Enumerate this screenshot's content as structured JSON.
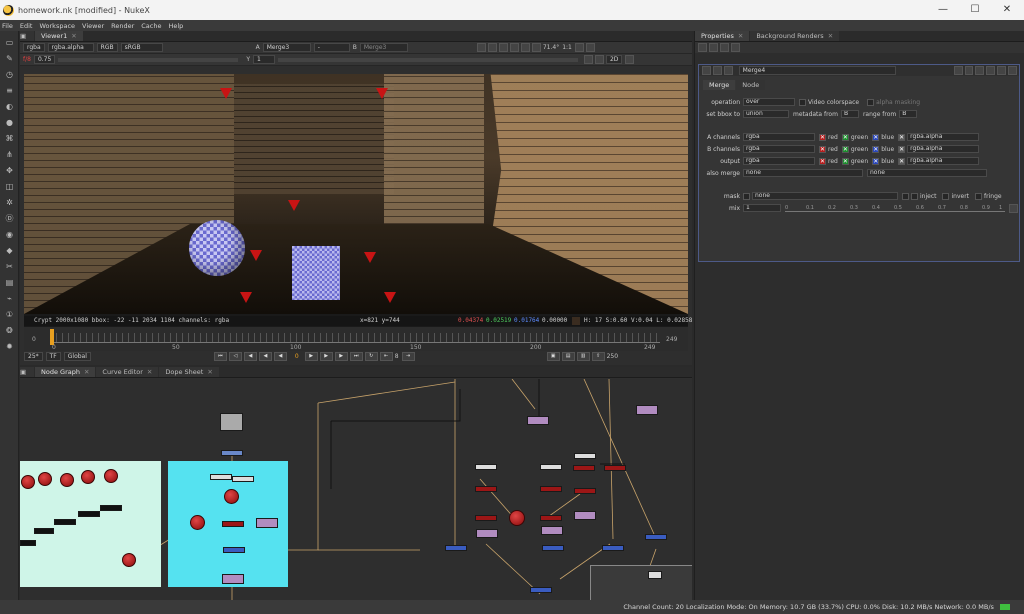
{
  "window": {
    "title": "homework.nk [modified] - NukeX",
    "minimize": "—",
    "maximize": "☐",
    "close": "✕"
  },
  "menu": [
    "File",
    "Edit",
    "Workspace",
    "Viewer",
    "Render",
    "Cache",
    "Help"
  ],
  "viewer": {
    "tab": "Viewer1",
    "channels": "rgba",
    "layer": "rgba.alpha",
    "display": "RGB",
    "colorspace": "sRGB",
    "a_input": "Merge3",
    "a_op": "-",
    "b_input": "Merge3",
    "a_label": "A",
    "b_label": "B",
    "zoom": "71.4°",
    "ratio": "1:1",
    "gain_label": "f/8",
    "gain": "0.75",
    "gamma_label": "Y",
    "gamma": "1",
    "mode": "2D",
    "status": {
      "format": "Crypt 2000x1080  bbox: -22 -11 2034 1104 channels: rgba",
      "coords": "x=821 y=744",
      "r": "0.04374",
      "g": "0.02519",
      "b": "0.01764",
      "a": "0.00000",
      "hsv": "H: 17 S:0.60 V:0.04  L: 0.02858"
    }
  },
  "timeline": {
    "start": "0",
    "end": "249",
    "ticks": [
      "0",
      "50",
      "100",
      "150",
      "200",
      "249"
    ],
    "fps": "25*",
    "tf": "TF",
    "scope": "Global",
    "current": "0",
    "step": "8",
    "last": "250"
  },
  "graph_tabs": [
    "Node Graph",
    "Curve Editor",
    "Dope Sheet"
  ],
  "properties": {
    "tabs": [
      "Properties",
      "Background Renders"
    ],
    "node_name": "Merge4",
    "node_tabs": [
      "Merge",
      "Node"
    ],
    "operation_label": "operation",
    "operation": "over",
    "video_colorspace": "Video colorspace",
    "alpha_masking": "alpha masking",
    "bbox_label": "set bbox to",
    "bbox": "union",
    "metadata_label": "metadata from",
    "metadata": "B",
    "range_label": "range from",
    "range": "B",
    "a_channels_label": "A channels",
    "a_channels": "rgba",
    "b_channels_label": "B channels",
    "b_channels": "rgba",
    "output_label": "output",
    "output": "rgba",
    "also_merge_label": "also merge",
    "also_merge": "none",
    "also_merge2": "none",
    "ch_red": "red",
    "ch_green": "green",
    "ch_blue": "blue",
    "ch_alpha": "rgba.alpha",
    "mask_label": "mask",
    "mask": "none",
    "inject": "inject",
    "invert": "invert",
    "fringe": "fringe",
    "mix_label": "mix",
    "mix": "1",
    "mix_ticks": [
      "0",
      "0.1",
      "0.2",
      "0.3",
      "0.4",
      "0.5",
      "0.6",
      "0.7",
      "0.8",
      "0.9",
      "1"
    ]
  },
  "statusbar": "Channel Count: 20  Localization Mode: On  Memory: 10.7 GB (33.7%)  CPU: 0.0%  Disk: 10.2 MB/s  Network: 0.0 MB/s"
}
